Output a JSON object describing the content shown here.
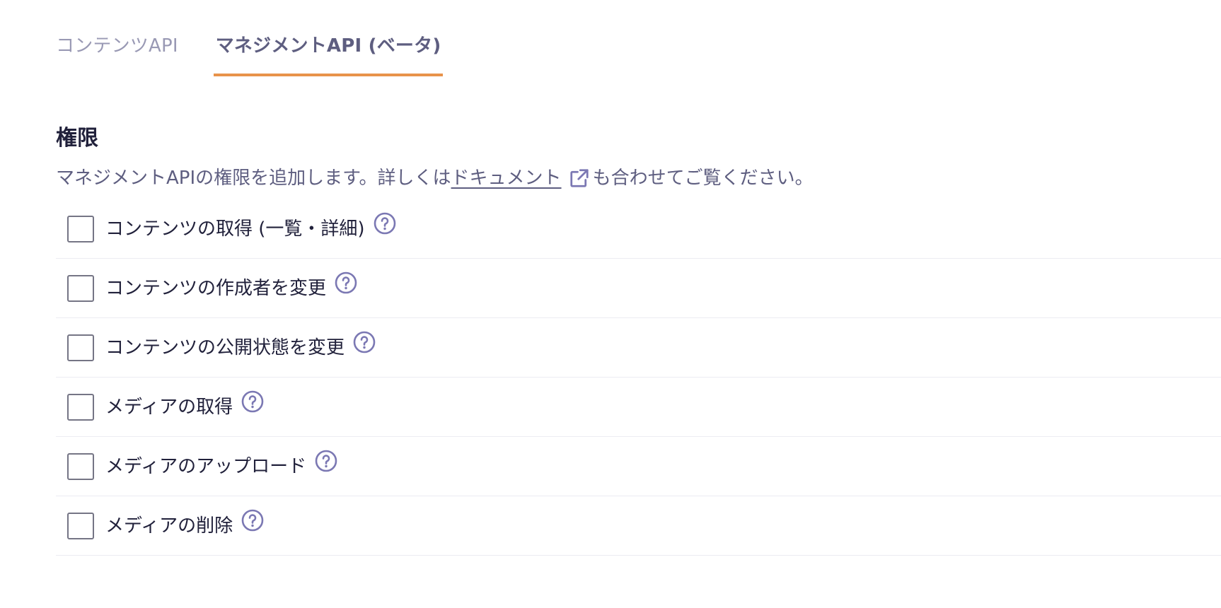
{
  "tabs": [
    {
      "label": "コンテンツAPI",
      "active": false
    },
    {
      "label": "マネジメントAPI (ベータ)",
      "active": true
    }
  ],
  "section": {
    "title": "権限",
    "description_before": "マネジメントAPIの権限を追加します。詳しくは",
    "link_text": "ドキュメント",
    "description_after": "も合わせてご覧ください。"
  },
  "permissions": [
    {
      "label": "コンテンツの取得 (一覧・詳細)",
      "checked": false
    },
    {
      "label": "コンテンツの作成者を変更",
      "checked": false
    },
    {
      "label": "コンテンツの公開状態を変更",
      "checked": false
    },
    {
      "label": "メディアの取得",
      "checked": false
    },
    {
      "label": "メディアのアップロード",
      "checked": false
    },
    {
      "label": "メディアの削除",
      "checked": false
    }
  ],
  "colors": {
    "accent": "#e8934a",
    "icon": "#7b78b3",
    "text_primary": "#21213b",
    "text_secondary": "#5e5e80",
    "tab_inactive": "#9999b4"
  },
  "icons": {
    "external_link": "external-link-icon",
    "help": "question-circle-icon"
  }
}
